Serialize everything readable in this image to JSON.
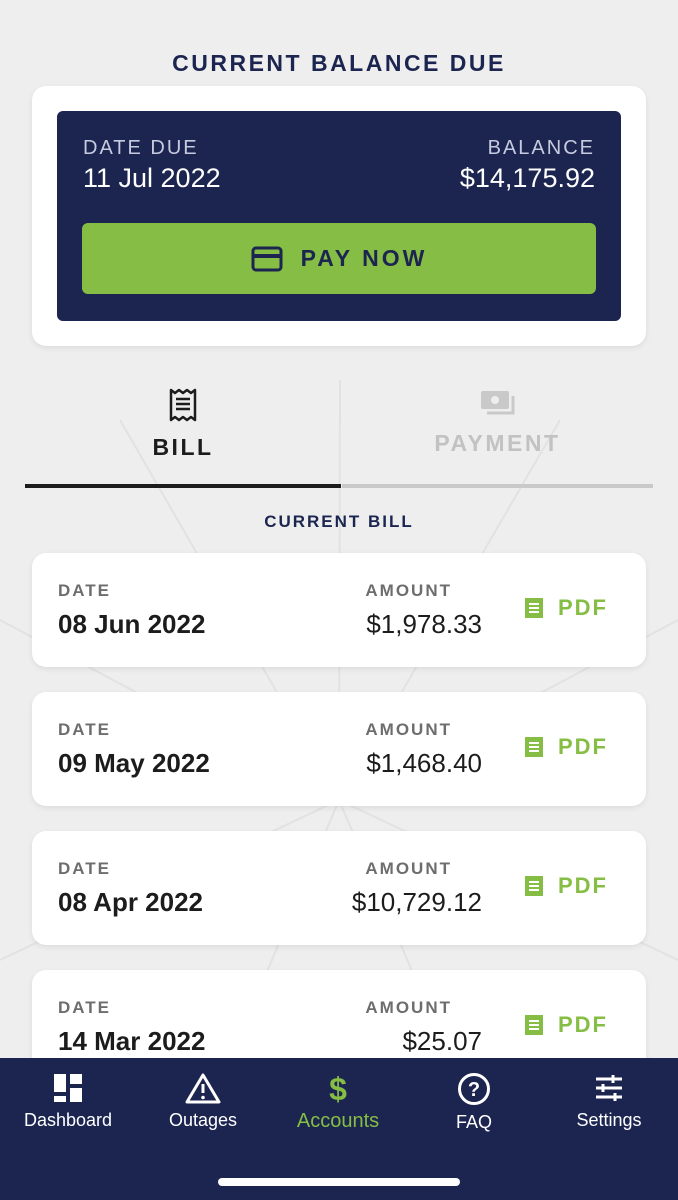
{
  "balance": {
    "title": "CURRENT BALANCE DUE",
    "date_due_label": "DATE DUE",
    "date_due": "11 Jul 2022",
    "balance_label": "BALANCE",
    "balance": "$14,175.92",
    "pay_button_label": "PAY NOW"
  },
  "tabs": {
    "bill": "BILL",
    "payment": "PAYMENT",
    "active": "bill"
  },
  "current_bill_title": "CURRENT BILL",
  "bills": [
    {
      "date_label": "DATE",
      "date": "08 Jun 2022",
      "amount_label": "AMOUNT",
      "amount": "$1,978.33",
      "pdf_label": "PDF"
    },
    {
      "date_label": "DATE",
      "date": "09 May 2022",
      "amount_label": "AMOUNT",
      "amount": "$1,468.40",
      "pdf_label": "PDF"
    },
    {
      "date_label": "DATE",
      "date": "08 Apr 2022",
      "amount_label": "AMOUNT",
      "amount": "$10,729.12",
      "pdf_label": "PDF"
    },
    {
      "date_label": "DATE",
      "date": "14 Mar 2022",
      "amount_label": "AMOUNT",
      "amount": "$25.07",
      "pdf_label": "PDF"
    }
  ],
  "nav": {
    "items": [
      {
        "label": "Dashboard",
        "icon": "dashboard-icon"
      },
      {
        "label": "Outages",
        "icon": "warning-icon"
      },
      {
        "label": "Accounts",
        "icon": "dollar-icon",
        "active": true
      },
      {
        "label": "FAQ",
        "icon": "help-icon"
      },
      {
        "label": "Settings",
        "icon": "sliders-icon"
      }
    ]
  },
  "colors": {
    "navy": "#1b2550",
    "accent_green": "#86bd45",
    "background": "#eeeeee",
    "card": "#ffffff"
  }
}
